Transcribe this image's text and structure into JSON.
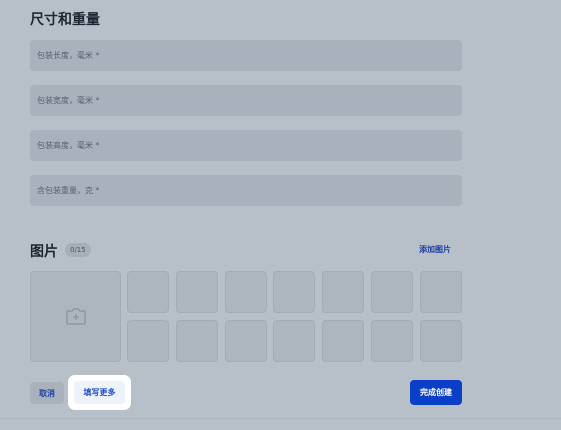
{
  "dimensions_section": {
    "title": "尺寸和重量",
    "fields": [
      {
        "placeholder": "包装长度，毫米 *"
      },
      {
        "placeholder": "包装宽度，毫米 *"
      },
      {
        "placeholder": "包装高度，毫米 *"
      },
      {
        "placeholder": "含包装重量，克 *"
      }
    ]
  },
  "photos_section": {
    "title": "图片",
    "count": "0/15",
    "add_link": "添加图片",
    "main_slot_icon": "add-photo-icon",
    "slot_count": 14
  },
  "footer": {
    "cancel_label": "取消",
    "more_label": "填写更多",
    "create_label": "完成创建"
  },
  "colors": {
    "accent": "#0b3fc7",
    "link": "#1f3fa6",
    "overlay_background": "#b7bfc8"
  }
}
